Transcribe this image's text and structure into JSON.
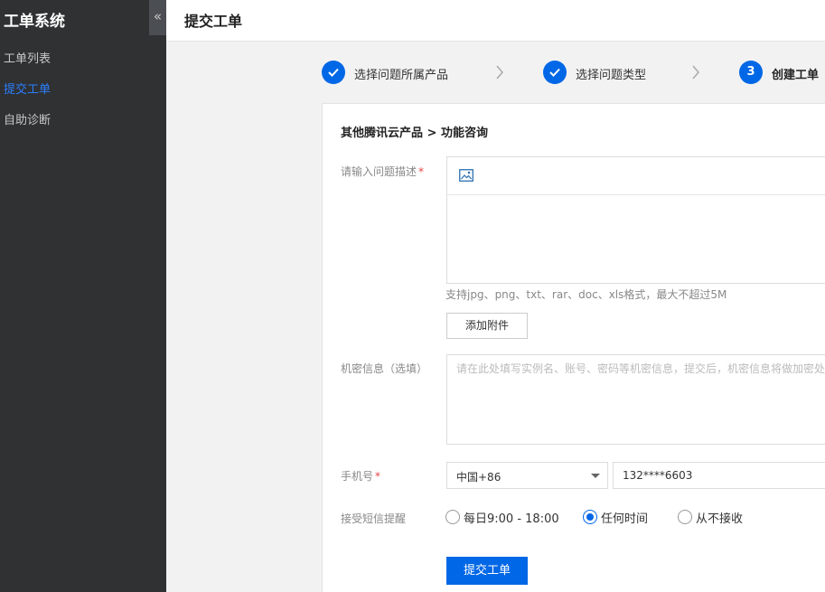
{
  "sidebar": {
    "app_title": "工单系统",
    "collapse_icon": "«",
    "items": [
      {
        "label": "工单列表",
        "active": false
      },
      {
        "label": "提交工单",
        "active": true
      },
      {
        "label": "自助诊断",
        "active": false
      }
    ]
  },
  "header": {
    "title": "提交工单"
  },
  "steps": [
    {
      "label": "选择问题所属产品",
      "state": "done"
    },
    {
      "label": "选择问题类型",
      "state": "done"
    },
    {
      "number": "3",
      "label": "创建工单",
      "state": "current"
    }
  ],
  "form": {
    "breadcrumb": "其他腾讯云产品 > 功能咨询",
    "description_label": "请输入问题描述",
    "required_mark": "*",
    "attachment_hint": "支持jpg、png、txt、rar、doc、xls格式，最大不超过5M",
    "add_attachment_label": "添加附件",
    "secret_label": "机密信息（选填）",
    "secret_placeholder": "请在此处填写实例名、账号、密码等机密信息，提交后，机密信息将做加密处理",
    "phone_label": "手机号",
    "country_code": "中国+86",
    "phone_value": "132****6603",
    "sms_label": "接受短信提醒",
    "sms_options": [
      {
        "label": "每日9:00 - 18:00",
        "checked": false
      },
      {
        "label": "任何时间",
        "checked": true
      },
      {
        "label": "从不接收",
        "checked": false
      }
    ],
    "submit_label": "提交工单"
  },
  "colors": {
    "accent": "#0067e6",
    "sidebar_bg": "#2f3133",
    "nav_active": "#2b7fff",
    "required": "#e54545"
  }
}
